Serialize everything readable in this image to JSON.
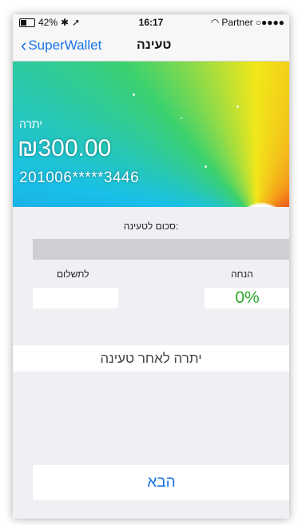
{
  "status_bar": {
    "battery": "42%",
    "bluetooth_icon": "bluetooth-icon",
    "location_icon": "location-arrow-icon",
    "time": "16:17",
    "wifi_icon": "wifi-icon",
    "carrier": "Partner",
    "signal": "○●●●●"
  },
  "nav": {
    "back_label": "SuperWallet",
    "title": "טעינה"
  },
  "card": {
    "balance_label": "יתרה",
    "balance_amount": "₪300.00",
    "card_number": "201006*****3446"
  },
  "form": {
    "amount_label": "סכום לטעינה:",
    "amount_value": "",
    "payment_label": "לתשלום",
    "payment_value": "",
    "discount_label": "הנחה",
    "discount_value": "0%",
    "after_balance_label": "יתרה לאחר טעינה"
  },
  "actions": {
    "next_label": "הבא"
  },
  "colors": {
    "accent": "#1a73e8",
    "discount": "#2aa82a"
  }
}
